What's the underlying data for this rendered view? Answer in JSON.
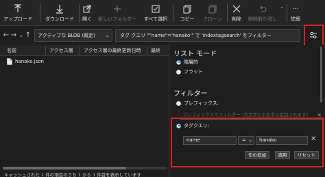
{
  "toolbar": {
    "upload": "アップロード",
    "download": "ダウンロード",
    "open": "開く",
    "new_folder": "新しいフォルダー",
    "select_all": "すべて選択",
    "copy": "コピー",
    "clone": "クローン",
    "delete": "削除",
    "undelete": "削除取り消し",
    "details": "詳細"
  },
  "address": {
    "blob_select": "アクティブな BLOB (既定)",
    "filter_text": "タグ クエリ \"\"name\"='hanako'\" で 'indextagsearch' をフィルター"
  },
  "table": {
    "columns": [
      "名前",
      "アクセス層",
      "アクセス層の最終更新日時",
      "最終"
    ],
    "rows": [
      {
        "name": "hanako.json"
      }
    ]
  },
  "status": "キャッシュされた 1 件の項目のうち 1 から 1 件目を表示しています",
  "panel": {
    "list_mode_heading": "リスト モード",
    "hierarchical": "階層的",
    "flat": "フラット",
    "filter_heading": "フィルター",
    "prefix": "プレフィックス:",
    "prefix_placeholder": "プレフィックスでフィルター (大文字と小文字は区別されます)",
    "tag_query": "タグクエリ:",
    "tag_name": "name",
    "tag_op": "=",
    "tag_value": "hanako",
    "btn_add_clause": "句の追加",
    "btn_apply": "適用",
    "btn_reset": "リセット"
  },
  "colors": {
    "highlight": "#e02020",
    "background": "#1e1e1e",
    "radio_accent": "#4a90d9"
  }
}
